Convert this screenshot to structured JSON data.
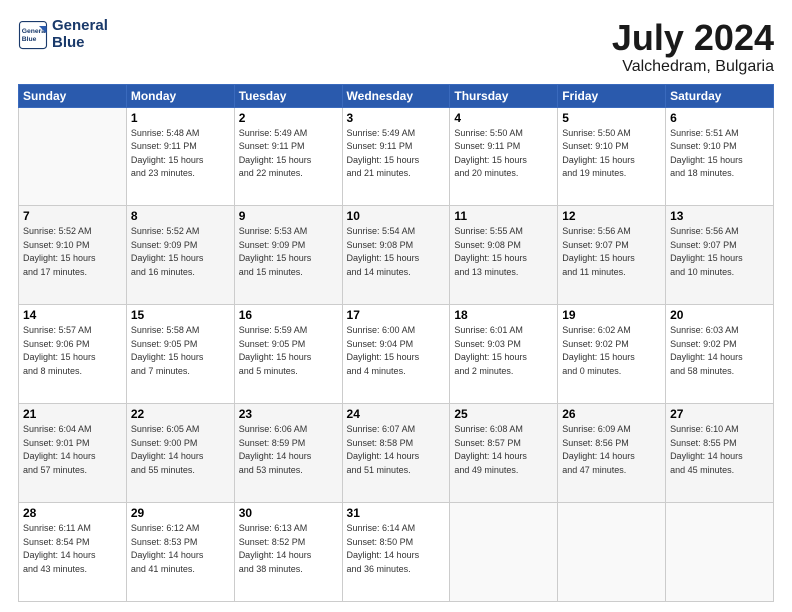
{
  "header": {
    "logo_line1": "General",
    "logo_line2": "Blue",
    "month": "July 2024",
    "location": "Valchedram, Bulgaria"
  },
  "weekdays": [
    "Sunday",
    "Monday",
    "Tuesday",
    "Wednesday",
    "Thursday",
    "Friday",
    "Saturday"
  ],
  "weeks": [
    [
      {
        "day": "",
        "info": ""
      },
      {
        "day": "1",
        "info": "Sunrise: 5:48 AM\nSunset: 9:11 PM\nDaylight: 15 hours\nand 23 minutes."
      },
      {
        "day": "2",
        "info": "Sunrise: 5:49 AM\nSunset: 9:11 PM\nDaylight: 15 hours\nand 22 minutes."
      },
      {
        "day": "3",
        "info": "Sunrise: 5:49 AM\nSunset: 9:11 PM\nDaylight: 15 hours\nand 21 minutes."
      },
      {
        "day": "4",
        "info": "Sunrise: 5:50 AM\nSunset: 9:11 PM\nDaylight: 15 hours\nand 20 minutes."
      },
      {
        "day": "5",
        "info": "Sunrise: 5:50 AM\nSunset: 9:10 PM\nDaylight: 15 hours\nand 19 minutes."
      },
      {
        "day": "6",
        "info": "Sunrise: 5:51 AM\nSunset: 9:10 PM\nDaylight: 15 hours\nand 18 minutes."
      }
    ],
    [
      {
        "day": "7",
        "info": "Sunrise: 5:52 AM\nSunset: 9:10 PM\nDaylight: 15 hours\nand 17 minutes."
      },
      {
        "day": "8",
        "info": "Sunrise: 5:52 AM\nSunset: 9:09 PM\nDaylight: 15 hours\nand 16 minutes."
      },
      {
        "day": "9",
        "info": "Sunrise: 5:53 AM\nSunset: 9:09 PM\nDaylight: 15 hours\nand 15 minutes."
      },
      {
        "day": "10",
        "info": "Sunrise: 5:54 AM\nSunset: 9:08 PM\nDaylight: 15 hours\nand 14 minutes."
      },
      {
        "day": "11",
        "info": "Sunrise: 5:55 AM\nSunset: 9:08 PM\nDaylight: 15 hours\nand 13 minutes."
      },
      {
        "day": "12",
        "info": "Sunrise: 5:56 AM\nSunset: 9:07 PM\nDaylight: 15 hours\nand 11 minutes."
      },
      {
        "day": "13",
        "info": "Sunrise: 5:56 AM\nSunset: 9:07 PM\nDaylight: 15 hours\nand 10 minutes."
      }
    ],
    [
      {
        "day": "14",
        "info": "Sunrise: 5:57 AM\nSunset: 9:06 PM\nDaylight: 15 hours\nand 8 minutes."
      },
      {
        "day": "15",
        "info": "Sunrise: 5:58 AM\nSunset: 9:05 PM\nDaylight: 15 hours\nand 7 minutes."
      },
      {
        "day": "16",
        "info": "Sunrise: 5:59 AM\nSunset: 9:05 PM\nDaylight: 15 hours\nand 5 minutes."
      },
      {
        "day": "17",
        "info": "Sunrise: 6:00 AM\nSunset: 9:04 PM\nDaylight: 15 hours\nand 4 minutes."
      },
      {
        "day": "18",
        "info": "Sunrise: 6:01 AM\nSunset: 9:03 PM\nDaylight: 15 hours\nand 2 minutes."
      },
      {
        "day": "19",
        "info": "Sunrise: 6:02 AM\nSunset: 9:02 PM\nDaylight: 15 hours\nand 0 minutes."
      },
      {
        "day": "20",
        "info": "Sunrise: 6:03 AM\nSunset: 9:02 PM\nDaylight: 14 hours\nand 58 minutes."
      }
    ],
    [
      {
        "day": "21",
        "info": "Sunrise: 6:04 AM\nSunset: 9:01 PM\nDaylight: 14 hours\nand 57 minutes."
      },
      {
        "day": "22",
        "info": "Sunrise: 6:05 AM\nSunset: 9:00 PM\nDaylight: 14 hours\nand 55 minutes."
      },
      {
        "day": "23",
        "info": "Sunrise: 6:06 AM\nSunset: 8:59 PM\nDaylight: 14 hours\nand 53 minutes."
      },
      {
        "day": "24",
        "info": "Sunrise: 6:07 AM\nSunset: 8:58 PM\nDaylight: 14 hours\nand 51 minutes."
      },
      {
        "day": "25",
        "info": "Sunrise: 6:08 AM\nSunset: 8:57 PM\nDaylight: 14 hours\nand 49 minutes."
      },
      {
        "day": "26",
        "info": "Sunrise: 6:09 AM\nSunset: 8:56 PM\nDaylight: 14 hours\nand 47 minutes."
      },
      {
        "day": "27",
        "info": "Sunrise: 6:10 AM\nSunset: 8:55 PM\nDaylight: 14 hours\nand 45 minutes."
      }
    ],
    [
      {
        "day": "28",
        "info": "Sunrise: 6:11 AM\nSunset: 8:54 PM\nDaylight: 14 hours\nand 43 minutes."
      },
      {
        "day": "29",
        "info": "Sunrise: 6:12 AM\nSunset: 8:53 PM\nDaylight: 14 hours\nand 41 minutes."
      },
      {
        "day": "30",
        "info": "Sunrise: 6:13 AM\nSunset: 8:52 PM\nDaylight: 14 hours\nand 38 minutes."
      },
      {
        "day": "31",
        "info": "Sunrise: 6:14 AM\nSunset: 8:50 PM\nDaylight: 14 hours\nand 36 minutes."
      },
      {
        "day": "",
        "info": ""
      },
      {
        "day": "",
        "info": ""
      },
      {
        "day": "",
        "info": ""
      }
    ]
  ]
}
